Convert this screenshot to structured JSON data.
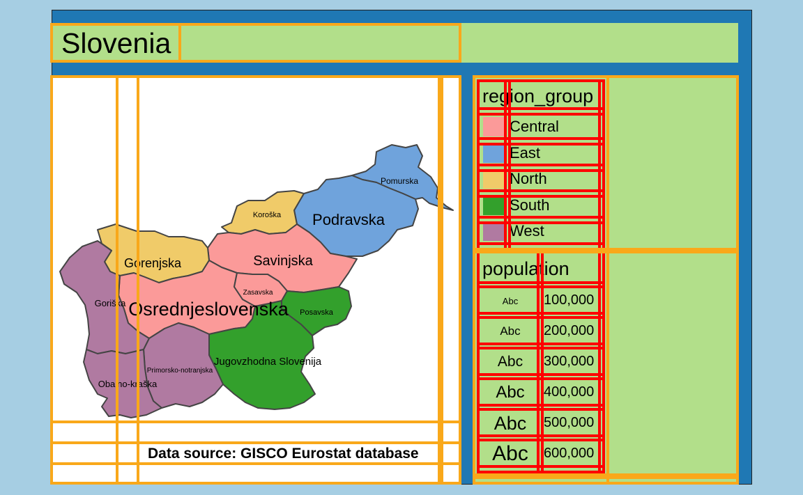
{
  "title": "Slovenia",
  "caption": "Data source: GISCO Eurostat database",
  "colors": {
    "background": "#a6cee3",
    "panel_blue": "#1f78b4",
    "panel_green": "#b2df8a",
    "frame_orange": "#f9a81a",
    "frame_red": "#ff0000",
    "border_gray": "#444444"
  },
  "legend_region": {
    "title": "region_group",
    "items": [
      {
        "label": "Central",
        "color": "#fb9a99"
      },
      {
        "label": "East",
        "color": "#6fa3dc"
      },
      {
        "label": "North",
        "color": "#f0cb69"
      },
      {
        "label": "South",
        "color": "#33a02c"
      },
      {
        "label": "West",
        "color": "#b07aa1"
      }
    ]
  },
  "legend_population": {
    "title": "population",
    "symbol": "Abc",
    "items": [
      {
        "label": "100,000",
        "value": 100000
      },
      {
        "label": "200,000",
        "value": 200000
      },
      {
        "label": "300,000",
        "value": 300000
      },
      {
        "label": "400,000",
        "value": 400000
      },
      {
        "label": "500,000",
        "value": 500000
      },
      {
        "label": "600,000",
        "value": 600000
      }
    ]
  },
  "regions": [
    {
      "name": "Pomurska",
      "group": "East",
      "population": 110000
    },
    {
      "name": "Podravska",
      "group": "East",
      "population": 325000
    },
    {
      "name": "Koroška",
      "group": "North",
      "population": 70000
    },
    {
      "name": "Savinjska",
      "group": "Central",
      "population": 255000
    },
    {
      "name": "Gorenjska",
      "group": "North",
      "population": 205000
    },
    {
      "name": "Zasavska",
      "group": "Central",
      "population": 57000
    },
    {
      "name": "Posavska",
      "group": "South",
      "population": 75000
    },
    {
      "name": "Goriška",
      "group": "West",
      "population": 117000
    },
    {
      "name": "Osrednjeslovenska",
      "group": "Central",
      "population": 545000
    },
    {
      "name": "Jugovzhodna Slovenija",
      "group": "South",
      "population": 145000
    },
    {
      "name": "Primorsko-notranjska",
      "group": "West",
      "population": 53000
    },
    {
      "name": "Obalno-kraška",
      "group": "West",
      "population": 115000
    }
  ]
}
